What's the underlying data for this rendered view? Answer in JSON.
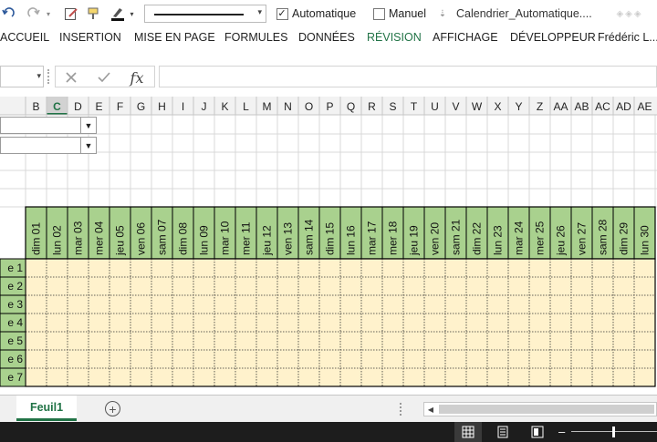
{
  "qat": {
    "calc_auto_label": "Automatique",
    "calc_manual_label": "Manuel",
    "doc_title": "Calendrier_Automatique...."
  },
  "ribbon": {
    "tabs": [
      "ACCUEIL",
      "INSERTION",
      "MISE EN PAGE",
      "FORMULES",
      "DONNÉES",
      "RÉVISION",
      "AFFICHAGE",
      "DÉVELOPPEUR",
      "Frédéric L..."
    ],
    "active_tab": "RÉVISION"
  },
  "formula_bar": {
    "fx_label": "fx",
    "content": ""
  },
  "sheet": {
    "columns": [
      "B",
      "C",
      "D",
      "E",
      "F",
      "G",
      "H",
      "I",
      "J",
      "K",
      "L",
      "M",
      "N",
      "O",
      "P",
      "Q",
      "R",
      "S",
      "T",
      "U",
      "V",
      "W",
      "X",
      "Y",
      "Z",
      "AA",
      "AB",
      "AC",
      "AD",
      "AE"
    ],
    "selected_column": "C",
    "days": [
      "dim 01",
      "lun 02",
      "mar 03",
      "mer 04",
      "jeu 05",
      "ven 06",
      "sam 07",
      "dim 08",
      "lun 09",
      "mar 10",
      "mer 11",
      "jeu 12",
      "ven 13",
      "sam 14",
      "dim 15",
      "lun 16",
      "mar 17",
      "mer 18",
      "jeu 19",
      "ven 20",
      "sam 21",
      "dim 22",
      "lun 23",
      "mar 24",
      "mer 25",
      "jeu 26",
      "ven 27",
      "sam 28",
      "dim 29",
      "lun 30"
    ],
    "row_labels": [
      "e 1",
      "e 2",
      "e 3",
      "e 4",
      "e 5",
      "e 6",
      "e 7"
    ],
    "colors": {
      "header_green": "#a9d18e",
      "cell_yellow": "#fff2cc",
      "grid_line": "#d9d9d9",
      "heading_bg": "#f2f2f2"
    }
  },
  "sheet_tabs": {
    "active": "Feuil1"
  },
  "accent": "#217346"
}
